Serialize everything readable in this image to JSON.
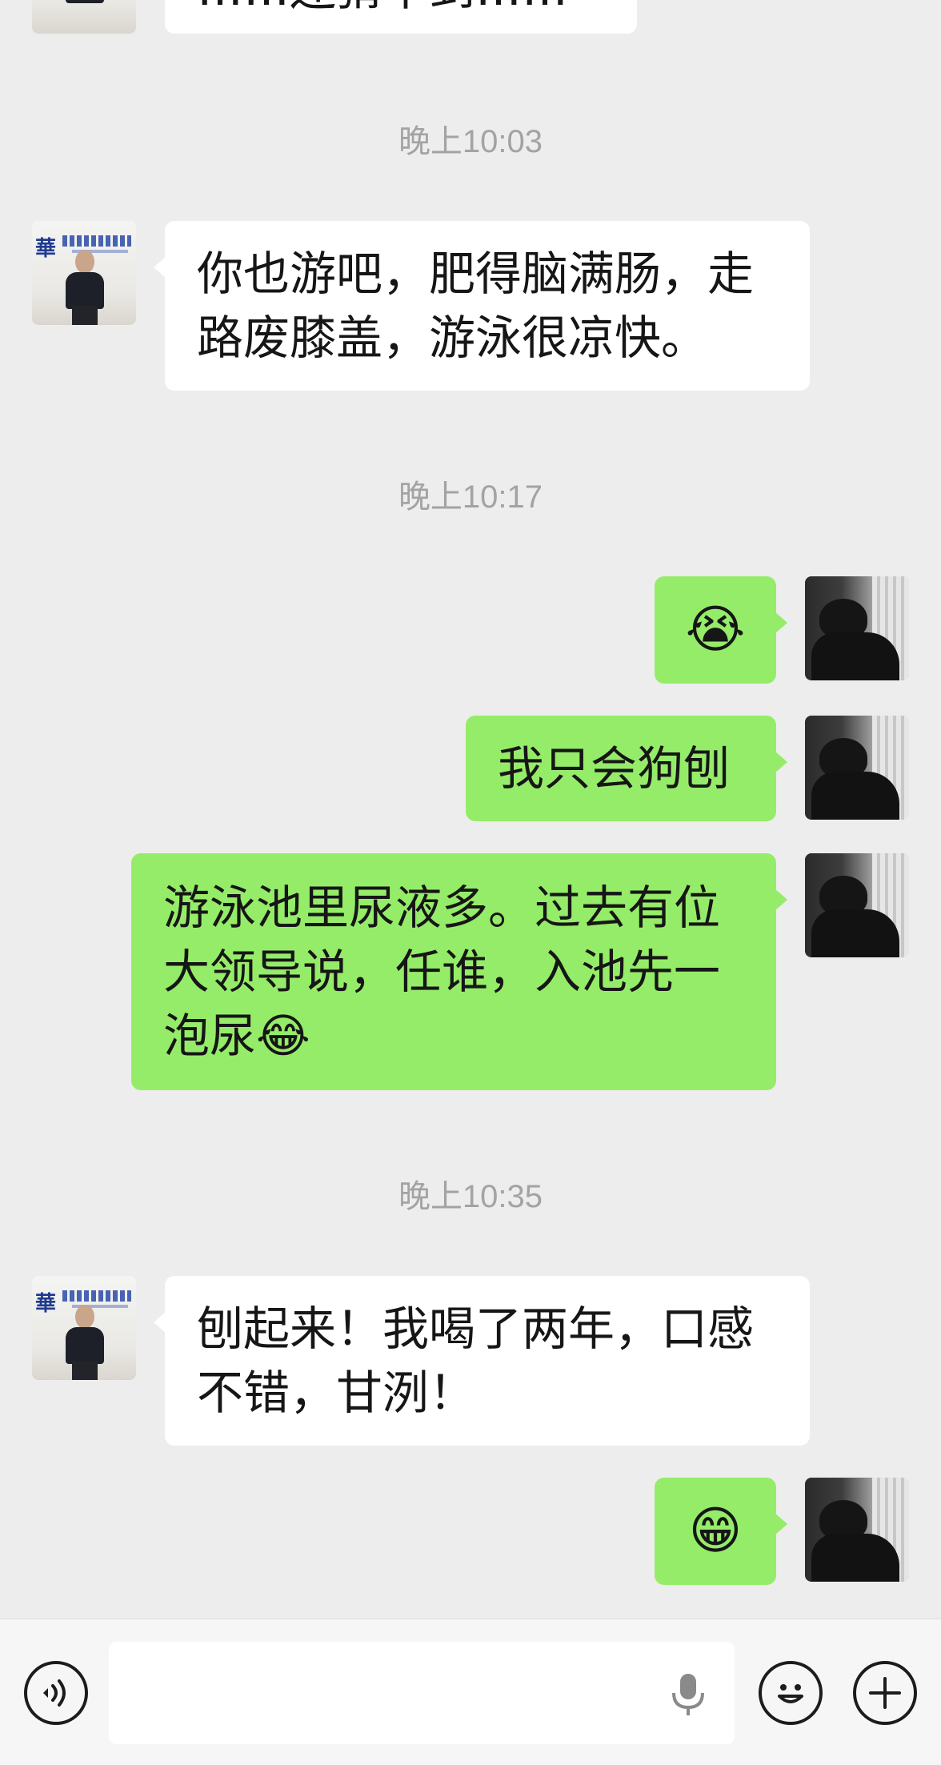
{
  "messages": [
    {
      "type": "in",
      "lines": [
        "……还猜不到……"
      ]
    },
    {
      "type": "time",
      "text": "晚上10:03"
    },
    {
      "type": "in",
      "lines": [
        "你也游吧，肥得脑满肠，走",
        "路废膝盖，游泳很凉快。"
      ]
    },
    {
      "type": "time",
      "text": "晚上10:17"
    },
    {
      "type": "out",
      "emoji": "😭"
    },
    {
      "type": "out",
      "lines": [
        "我只会狗刨"
      ]
    },
    {
      "type": "out",
      "lines": [
        "游泳池里尿液多。过去有位",
        "大领导说，任谁，入池先一",
        "泡尿"
      ],
      "trailing_emoji": "😂"
    },
    {
      "type": "time",
      "text": "晚上10:35"
    },
    {
      "type": "in",
      "lines": [
        "刨起来！我喝了两年，口感",
        "不错，甘洌！"
      ]
    },
    {
      "type": "out",
      "emoji": "😁"
    }
  ],
  "icons": {
    "voice": "voice-icon",
    "mic": "microphone-icon",
    "emoji": "emoji-icon",
    "plus": "plus-icon"
  },
  "colors": {
    "background": "#ededed",
    "incoming_bubble": "#ffffff",
    "outgoing_bubble": "#95ec69",
    "timestamp": "#a3a3a3"
  }
}
